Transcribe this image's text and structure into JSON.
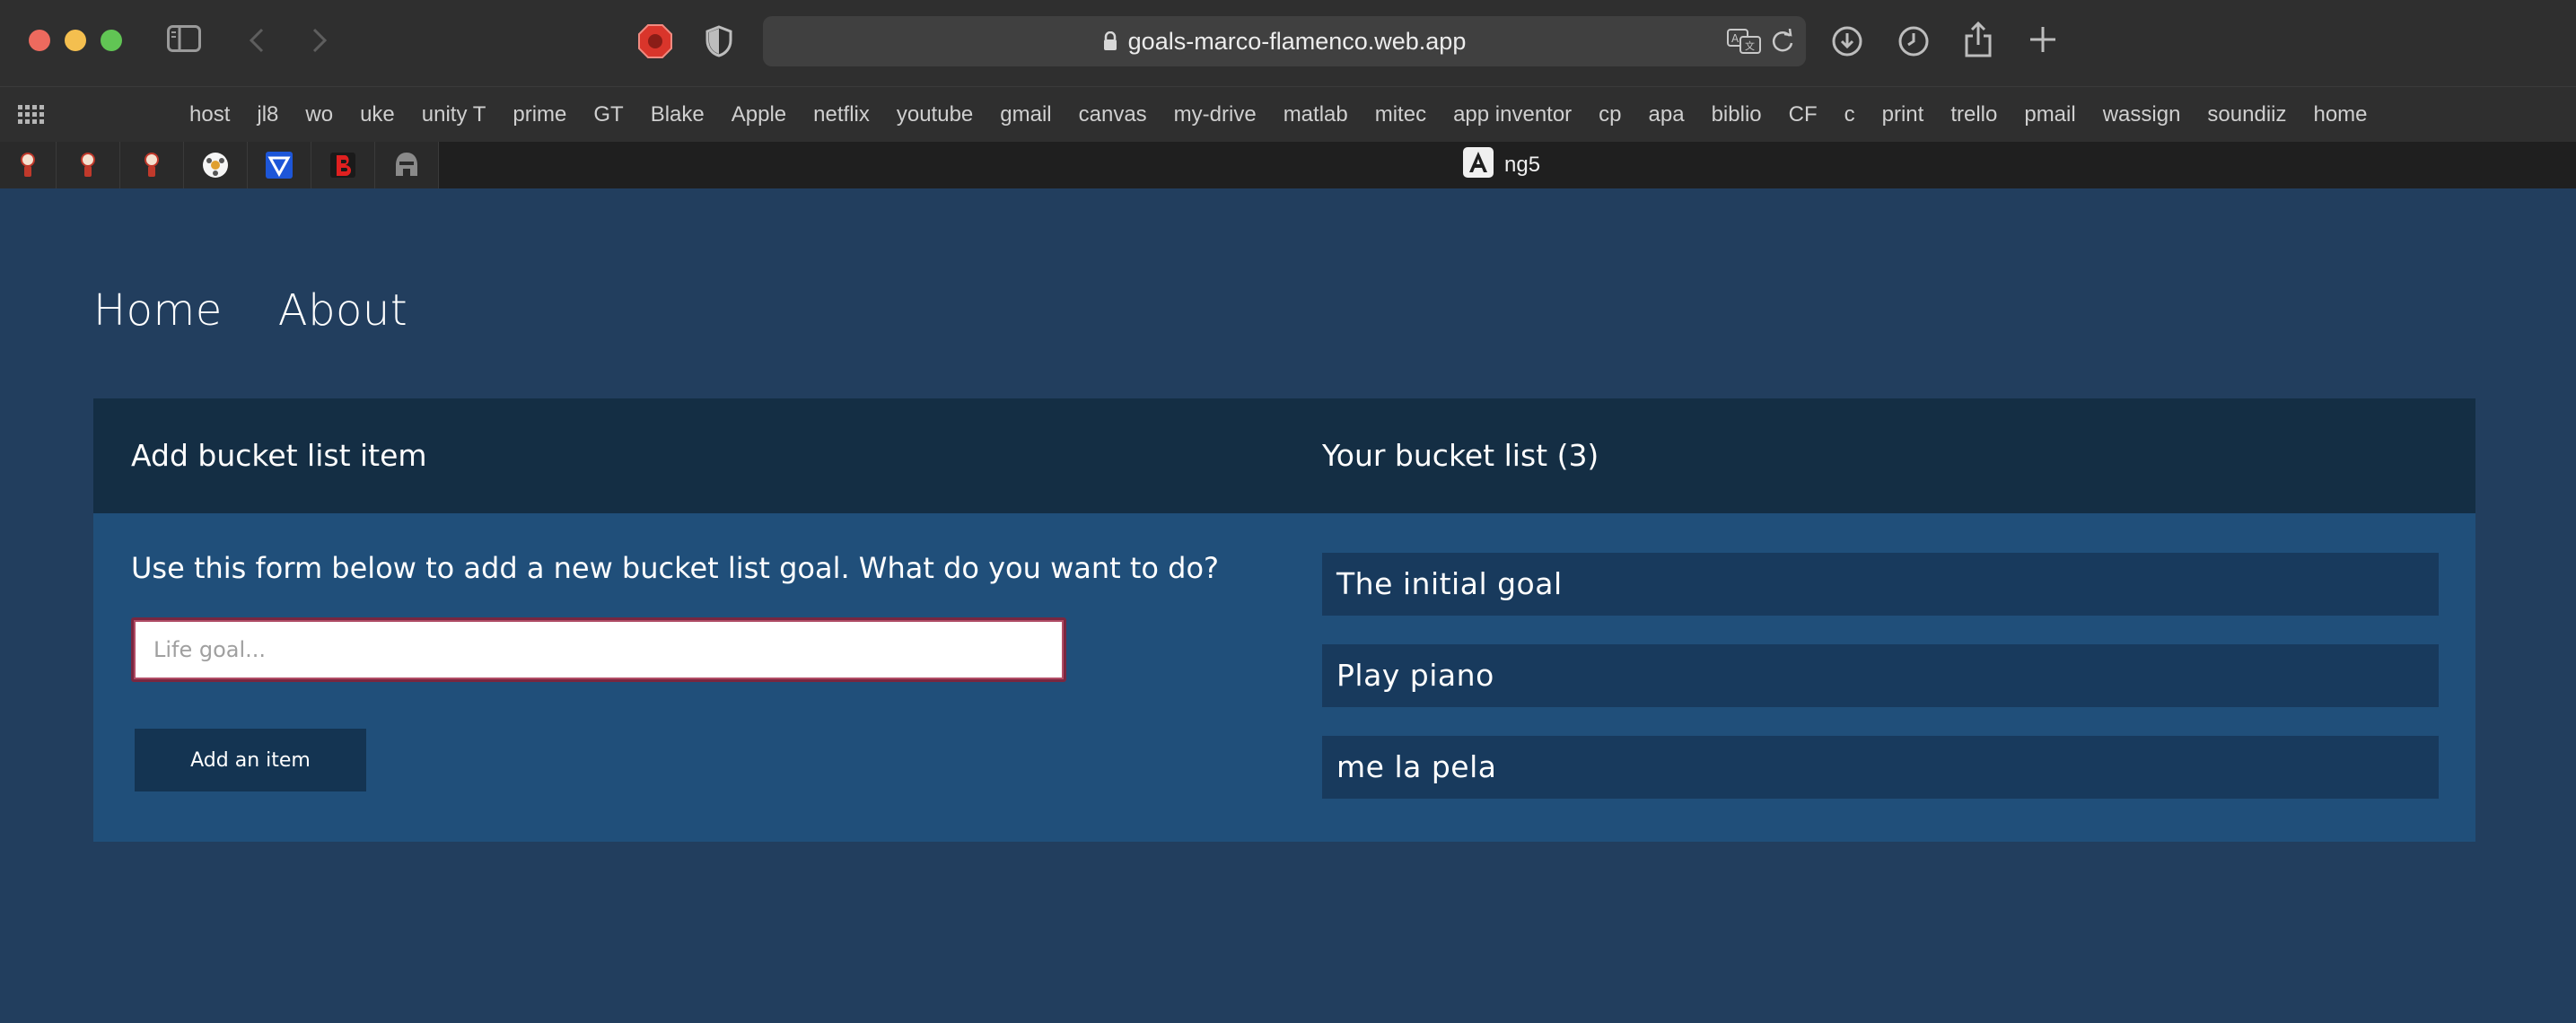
{
  "browser": {
    "url": "goals-marco-flamenco.web.app",
    "bookmarks": [
      "host",
      "jl8",
      "wo",
      "uke",
      "unity T",
      "prime",
      "GT",
      "Blake",
      "Apple",
      "netflix",
      "youtube",
      "gmail",
      "canvas",
      "my-drive",
      "matlab",
      "mitec",
      "app inventor",
      "cp",
      "apa",
      "biblio",
      "CF",
      "c",
      "print",
      "trello",
      "pmail",
      "wassign",
      "soundiiz",
      "home"
    ],
    "pinned_tabs": [
      "pinned-tab-1",
      "pinned-tab-2",
      "pinned-tab-3",
      "pinned-tab-4",
      "pinned-tab-5",
      "pinned-tab-6",
      "pinned-tab-7"
    ],
    "active_tab": {
      "title": "ng5",
      "icon": "angular-icon"
    }
  },
  "nav": {
    "home": "Home",
    "about": "About"
  },
  "add_panel": {
    "title": "Add bucket list item",
    "description": "Use this form below to add a new bucket list goal. What do you want to do?",
    "input_placeholder": "Life goal...",
    "input_value": "",
    "button_label": "Add an item"
  },
  "list_panel": {
    "title": "Your bucket list (3)",
    "items": [
      "The initial goal",
      "Play piano",
      "me la pela"
    ]
  },
  "colors": {
    "page_bg": "#223e5e",
    "header_bg": "#142e44",
    "body_bg": "#204f7a",
    "item_bg": "#183a5d",
    "button_bg": "#143452",
    "input_border": "#7a2740"
  }
}
